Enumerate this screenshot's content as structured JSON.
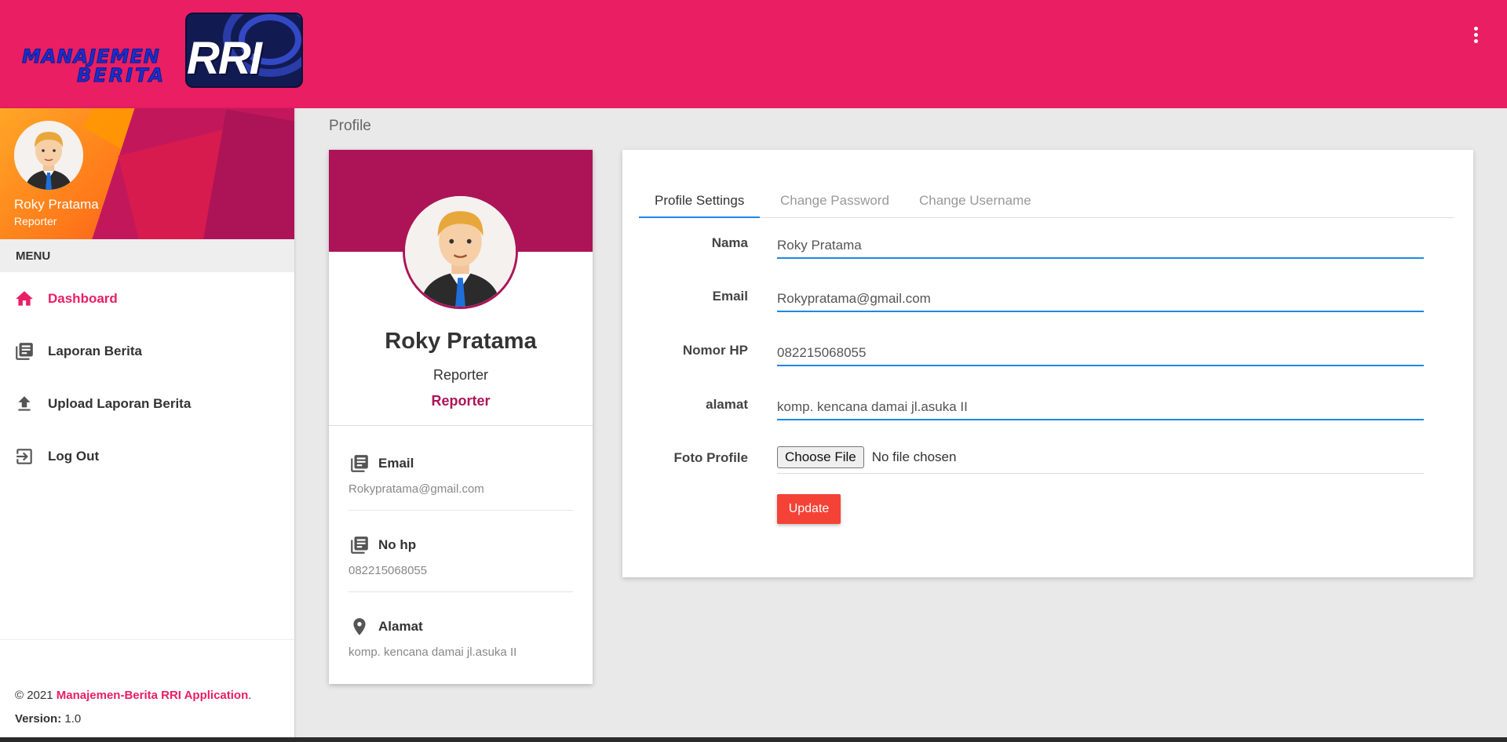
{
  "app": {
    "logo_line1": "MANAJEMEN",
    "logo_line2": "BERITA",
    "logo_mark": "RRI"
  },
  "topbar": {
    "menu_icon": "more-vert-icon"
  },
  "sidebar": {
    "user_name": "Roky Pratama",
    "user_role": "Reporter",
    "menu_header": "MENU",
    "items": [
      {
        "label": "Dashboard",
        "icon": "home-icon",
        "active": true
      },
      {
        "label": "Laporan Berita",
        "icon": "library-books-icon",
        "active": false
      },
      {
        "label": "Upload Laporan Berita",
        "icon": "upload-icon",
        "active": false
      },
      {
        "label": "Log Out",
        "icon": "logout-icon",
        "active": false
      }
    ],
    "footer": {
      "copyright": "© 2021",
      "brand": "Manajemen-Berita RRI Application",
      "period": ".",
      "version_label": "Version:",
      "version_value": "1.0"
    }
  },
  "breadcrumb": "Profile",
  "profile_card": {
    "name": "Roky Pratama",
    "role": "Reporter",
    "role_highlight": "Reporter",
    "info": [
      {
        "title": "Email",
        "icon": "library-books-icon",
        "value": "Rokypratama@gmail.com"
      },
      {
        "title": "No hp",
        "icon": "library-books-icon",
        "value": "082215068055"
      },
      {
        "title": "Alamat",
        "icon": "location-pin-icon",
        "value": "komp. kencana damai jl.asuka II"
      }
    ]
  },
  "settings": {
    "tabs": [
      {
        "label": "Profile Settings",
        "active": true
      },
      {
        "label": "Change Password",
        "active": false
      },
      {
        "label": "Change Username",
        "active": false
      }
    ],
    "fields": {
      "nama": {
        "label": "Nama",
        "value": "Roky Pratama"
      },
      "email": {
        "label": "Email",
        "value": "Rokypratama@gmail.com"
      },
      "nomor_hp": {
        "label": "Nomor HP",
        "value": "082215068055"
      },
      "alamat": {
        "label": "alamat",
        "value": "komp. kencana damai jl.asuka II"
      },
      "foto": {
        "label": "Foto Profile",
        "button": "Choose File",
        "status": "No file chosen"
      }
    },
    "submit_label": "Update"
  },
  "colors": {
    "primary": "#e91e63",
    "profile_header": "#ad1457",
    "input_underline": "#1e88e5",
    "update_button": "#f44336"
  }
}
